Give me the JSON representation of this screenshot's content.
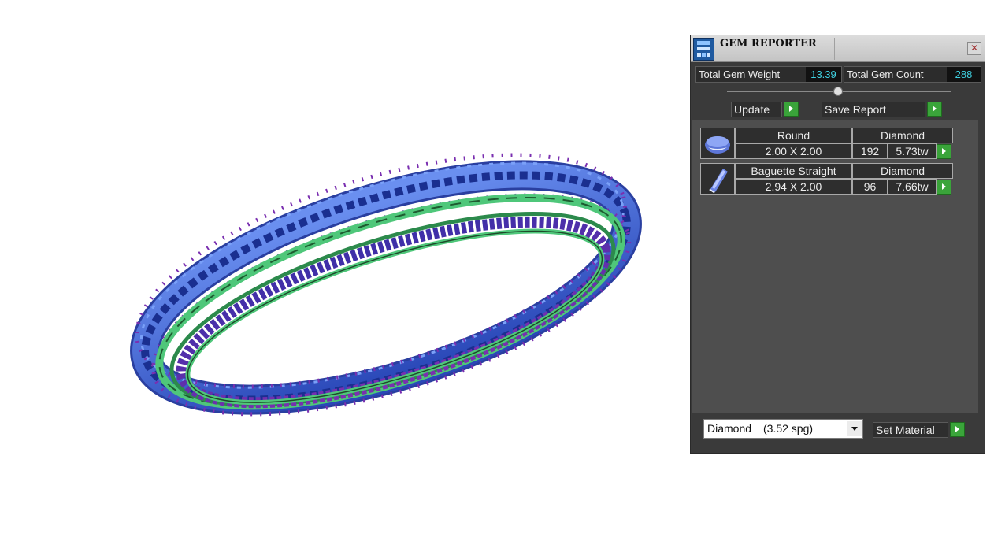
{
  "panel": {
    "title": "GEM REPORTER",
    "total_weight_label": "Total Gem Weight",
    "total_weight_value": "13.39",
    "total_count_label": "Total Gem Count",
    "total_count_value": "288",
    "update_label": "Update",
    "save_report_label": "Save Report",
    "value_color": "#3fd0e0",
    "button_color": "#3aa43a"
  },
  "gems": [
    {
      "icon": "round-gem-icon",
      "shape": "Round",
      "material": "Diamond",
      "size": "2.00 X 2.00",
      "count": "192",
      "weight": "5.73tw"
    },
    {
      "icon": "baguette-gem-icon",
      "shape": "Baguette Straight",
      "material": "Diamond",
      "size": "2.94 X 2.00",
      "count": "96",
      "weight": "7.66tw"
    }
  ],
  "material_selector": {
    "name": "Diamond",
    "sg": "(3.52 spg)",
    "set_label": "Set Material"
  },
  "viewport": {
    "model_icon": "bangle-ring-3d-model",
    "stone_color": "#4a6fe0",
    "metal_color": "#4fc77a",
    "prong_color": "#7a2fb0"
  }
}
